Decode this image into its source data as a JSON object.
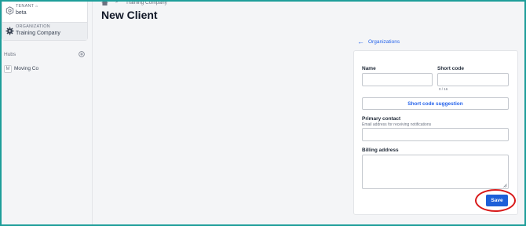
{
  "sidebar": {
    "tenant": {
      "caption": "TENANT",
      "value": "beta",
      "icon": "hexagon-gear-icon",
      "lock_icon": "lock-icon"
    },
    "organization": {
      "caption": "ORGANIZATION",
      "value": "Training Company",
      "icon": "gear-icon"
    },
    "hubs": {
      "label": "Hubs",
      "add_icon": "plus-circle-icon",
      "items": [
        {
          "avatar": "M",
          "label": "Moving Co"
        }
      ]
    }
  },
  "header": {
    "breadcrumb": {
      "home_icon": "home-icon",
      "separator": ">",
      "current": "Training Company"
    },
    "title": "New Client"
  },
  "form": {
    "back_link": "Organizations",
    "name_label": "Name",
    "name_value": "",
    "short_code_label": "Short code",
    "short_code_value": "",
    "short_code_counter": "0 / 16",
    "suggest_button": "Short code suggestion",
    "primary_contact_label": "Primary contact",
    "primary_contact_help": "Email address for receiving notifications",
    "primary_contact_value": "",
    "billing_address_label": "Billing address",
    "billing_address_value": "",
    "save_button": "Save"
  },
  "colors": {
    "accent": "#1d5fd8",
    "link": "#2563eb",
    "highlight": "#d81b1b",
    "frame": "#1e9e9a"
  }
}
